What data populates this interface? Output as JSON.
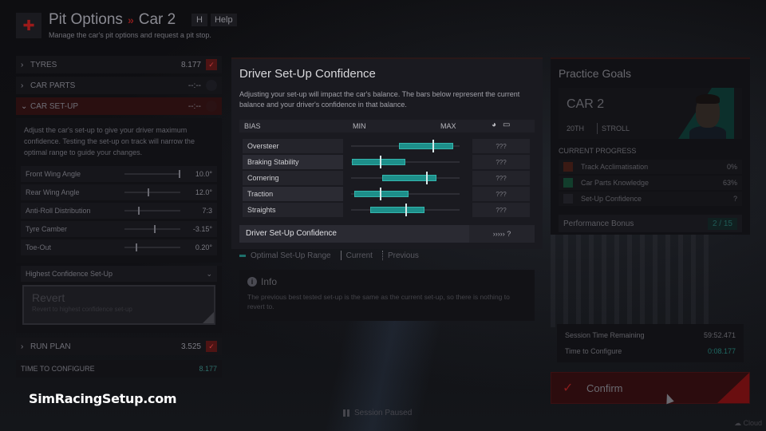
{
  "header": {
    "title": "Pit Options",
    "separator": "»",
    "subtitle_car": "Car 2",
    "help_key": "H",
    "help_label": "Help",
    "description": "Manage the car's pit options and request a pit stop."
  },
  "left_panel": {
    "sections": [
      {
        "label": "TYRES",
        "value": "8.177",
        "state": "checked",
        "expanded": false
      },
      {
        "label": "CAR PARTS",
        "value": "--:--",
        "state": "empty",
        "expanded": false
      },
      {
        "label": "CAR SET-UP",
        "value": "--:--",
        "state": "empty",
        "expanded": true
      }
    ],
    "setup_description": "Adjust the car's set-up to give your driver maximum confidence. Testing the set-up on track will narrow the optimal range to guide your changes.",
    "params": [
      {
        "name": "Front Wing Angle",
        "value": "10.0°",
        "position": 1.0
      },
      {
        "name": "Rear Wing Angle",
        "value": "12.0°",
        "position": 0.43
      },
      {
        "name": "Anti-Roll Distribution",
        "value": "7:3",
        "position": 0.25
      },
      {
        "name": "Tyre Camber",
        "value": "-3.15°",
        "position": 0.55
      },
      {
        "name": "Toe-Out",
        "value": "0.20°",
        "position": 0.2
      }
    ],
    "select": {
      "value": "Highest Confidence Set-Up",
      "chevron": "⌄"
    },
    "revert": {
      "title": "Revert",
      "subtitle": "Revert to highest confidence set-up"
    },
    "run_plan": {
      "label": "RUN PLAN",
      "value": "3.525",
      "state": "checked"
    },
    "time_to_configure": {
      "label": "TIME TO CONFIGURE",
      "value": "8.177"
    }
  },
  "center_panel": {
    "title": "Driver Set-Up Confidence",
    "description": "Adjusting your set-up will impact the car's balance. The bars below represent the current balance and your driver's confidence in that balance.",
    "columns": {
      "bias": "BIAS",
      "min": "MIN",
      "max": "MAX",
      "icons": [
        "engineer-icon",
        "chat-icon"
      ]
    },
    "rows": [
      {
        "name": "Oversteer",
        "range": [
          0.44,
          0.94
        ],
        "current": 0.76,
        "confidence": "???"
      },
      {
        "name": "Braking Stability",
        "range": [
          0.01,
          0.5
        ],
        "current": 0.27,
        "confidence": "???"
      },
      {
        "name": "Cornering",
        "range": [
          0.29,
          0.79
        ],
        "current": 0.7,
        "confidence": "???"
      },
      {
        "name": "Traction",
        "range": [
          0.03,
          0.53
        ],
        "current": 0.27,
        "confidence": "???"
      },
      {
        "name": "Straights",
        "range": [
          0.18,
          0.68
        ],
        "current": 0.51,
        "confidence": "???"
      }
    ],
    "summary": {
      "label": "Driver Set-Up Confidence",
      "value": "››››› ?"
    },
    "legend": {
      "range": "Optimal Set-Up Range",
      "current": "Current",
      "previous": "Previous"
    },
    "info": {
      "title": "Info",
      "icon": "i",
      "text": "The previous best tested set-up is the same as the current set-up, so there is nothing to revert to."
    },
    "colors": {
      "bar": "#1d8f8a",
      "bar_border": "#35b5ad"
    }
  },
  "right_panel": {
    "title": "Practice Goals",
    "car": {
      "name": "CAR 2",
      "position": "20TH",
      "driver": "STROLL"
    },
    "progress_title": "CURRENT PROGRESS",
    "progress": [
      {
        "label": "Track Acclimatisation",
        "value": "0%",
        "color": "#3a1a14"
      },
      {
        "label": "Car Parts Knowledge",
        "value": "63%",
        "color": "#123d2c"
      },
      {
        "label": "Set-Up Confidence",
        "value": "?",
        "color": "#1e1e24"
      }
    ],
    "performance_bonus": {
      "label": "Performance Bonus",
      "value": "2 / 15"
    }
  },
  "session": {
    "remaining_label": "Session Time Remaining",
    "remaining_value": "59:52.471",
    "configure_label": "Time to Configure",
    "configure_value": "0:08.177"
  },
  "confirm": {
    "label": "Confirm",
    "icon": "✓"
  },
  "footer": {
    "watermark": "SimRacingSetup.com",
    "paused": "Session Paused",
    "cloud": "Cloud"
  }
}
